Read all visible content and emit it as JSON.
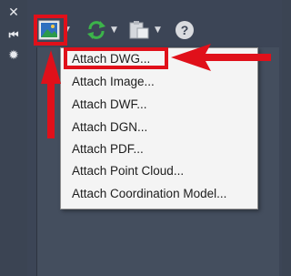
{
  "left_toolbar": {
    "close_glyph": "✕",
    "collapse_glyph": "⏮",
    "settings_glyph": "✹"
  },
  "toolbar": {
    "chevron": "▼",
    "help_glyph": "?"
  },
  "menu": {
    "items": [
      {
        "label": "Attach DWG..."
      },
      {
        "label": "Attach Image..."
      },
      {
        "label": "Attach DWF..."
      },
      {
        "label": "Attach DGN..."
      },
      {
        "label": "Attach PDF..."
      },
      {
        "label": "Attach Point Cloud..."
      },
      {
        "label": "Attach Coordination Model..."
      }
    ]
  },
  "colors": {
    "annotation_red": "#e0101a",
    "refresh_green": "#3cb44a",
    "panel_bg": "#3c4556",
    "menu_bg": "#f4f4f4"
  }
}
